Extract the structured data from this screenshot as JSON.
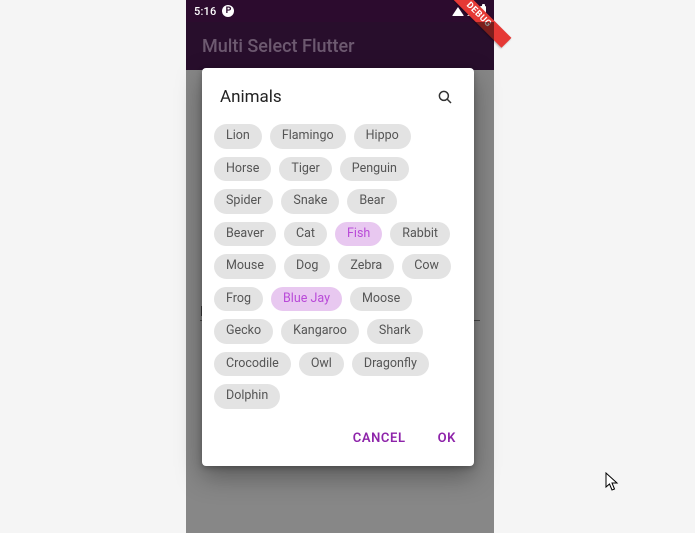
{
  "statusbar": {
    "time": "5:16",
    "badge": "P"
  },
  "appbar": {
    "title": "Multi Select Flutter"
  },
  "debug_banner": "DEBUG",
  "background": {
    "field_label_char": "F"
  },
  "dialog": {
    "title": "Animals",
    "cancel_label": "CANCEL",
    "ok_label": "OK",
    "chips": [
      {
        "label": "Lion",
        "selected": false
      },
      {
        "label": "Flamingo",
        "selected": false
      },
      {
        "label": "Hippo",
        "selected": false
      },
      {
        "label": "Horse",
        "selected": false
      },
      {
        "label": "Tiger",
        "selected": false
      },
      {
        "label": "Penguin",
        "selected": false
      },
      {
        "label": "Spider",
        "selected": false
      },
      {
        "label": "Snake",
        "selected": false
      },
      {
        "label": "Bear",
        "selected": false
      },
      {
        "label": "Beaver",
        "selected": false
      },
      {
        "label": "Cat",
        "selected": false
      },
      {
        "label": "Fish",
        "selected": true
      },
      {
        "label": "Rabbit",
        "selected": false
      },
      {
        "label": "Mouse",
        "selected": false
      },
      {
        "label": "Dog",
        "selected": false
      },
      {
        "label": "Zebra",
        "selected": false
      },
      {
        "label": "Cow",
        "selected": false
      },
      {
        "label": "Frog",
        "selected": false
      },
      {
        "label": "Blue Jay",
        "selected": true
      },
      {
        "label": "Moose",
        "selected": false
      },
      {
        "label": "Gecko",
        "selected": false
      },
      {
        "label": "Kangaroo",
        "selected": false
      },
      {
        "label": "Shark",
        "selected": false
      },
      {
        "label": "Crocodile",
        "selected": false
      },
      {
        "label": "Owl",
        "selected": false
      },
      {
        "label": "Dragonfly",
        "selected": false
      },
      {
        "label": "Dolphin",
        "selected": false
      }
    ]
  },
  "colors": {
    "accent": "#8e24aa",
    "chip_bg": "#e3e3e3",
    "chip_selected_bg": "#e8c8f0",
    "chip_selected_fg": "#b94ad8",
    "appbar_bg": "#4a1a52"
  }
}
